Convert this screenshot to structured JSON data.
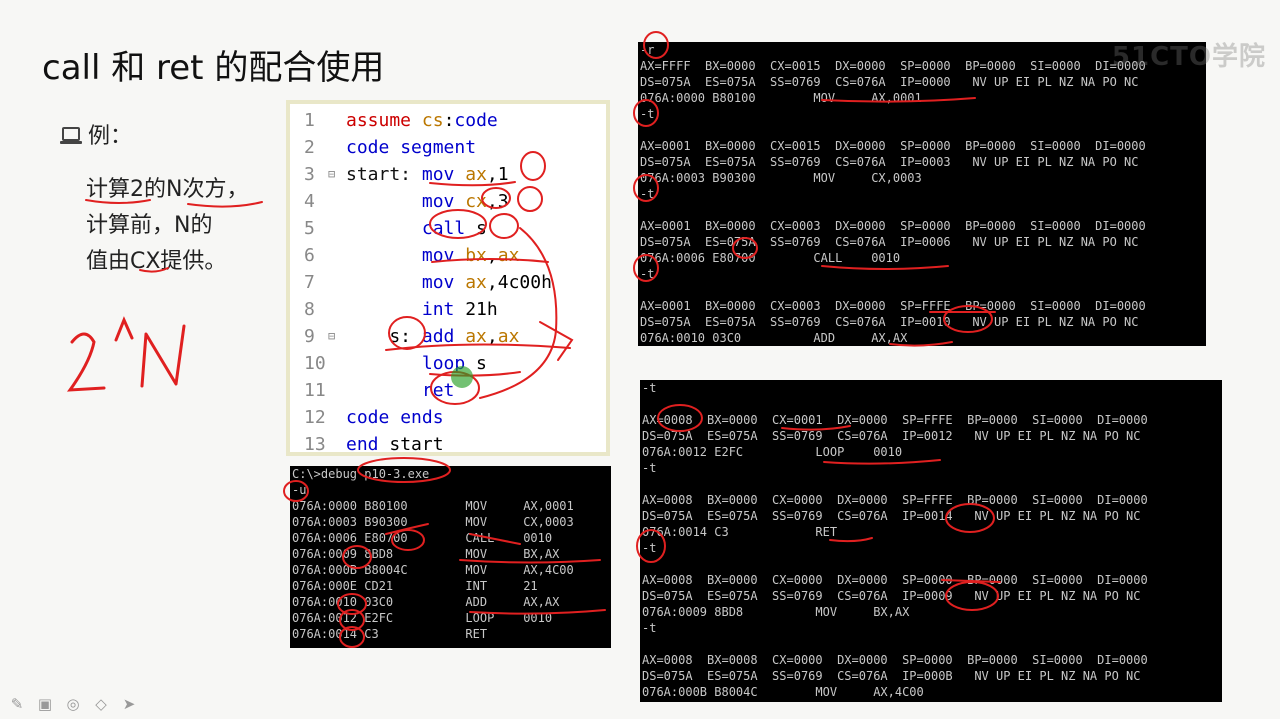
{
  "slide": {
    "title": "call 和 ret 的配合使用",
    "example_label": "例：",
    "description": [
      "计算2的N次方，",
      "计算前，N的",
      "值由CX提供。"
    ],
    "handwriting": "2^N",
    "watermark": "51CTO学院"
  },
  "code": {
    "lines": [
      {
        "n": "1",
        "fold": "",
        "text": "assume cs:code"
      },
      {
        "n": "2",
        "fold": "",
        "text": "code segment"
      },
      {
        "n": "3",
        "fold": "⊟",
        "text": "start: mov ax,1"
      },
      {
        "n": "4",
        "fold": "",
        "text": "       mov cx,3"
      },
      {
        "n": "5",
        "fold": "",
        "text": "       call s"
      },
      {
        "n": "6",
        "fold": "",
        "text": "       mov bx,ax"
      },
      {
        "n": "7",
        "fold": "",
        "text": "       mov ax,4c00h"
      },
      {
        "n": "8",
        "fold": "",
        "text": "       int 21h"
      },
      {
        "n": "9",
        "fold": "⊟",
        "text": "    s: add ax,ax"
      },
      {
        "n": "10",
        "fold": "",
        "text": "       loop s"
      },
      {
        "n": "11",
        "fold": "",
        "text": "       ret"
      },
      {
        "n": "12",
        "fold": "",
        "text": "code ends"
      },
      {
        "n": "13",
        "fold": "",
        "text": "end start"
      }
    ]
  },
  "terminal_top": {
    "lines": [
      "-r",
      "AX=FFFF  BX=0000  CX=0015  DX=0000  SP=0000  BP=0000  SI=0000  DI=0000",
      "DS=075A  ES=075A  SS=0769  CS=076A  IP=0000   NV UP EI PL NZ NA PO NC",
      "076A:0000 B80100        MOV     AX,0001",
      "-t",
      "",
      "AX=0001  BX=0000  CX=0015  DX=0000  SP=0000  BP=0000  SI=0000  DI=0000",
      "DS=075A  ES=075A  SS=0769  CS=076A  IP=0003   NV UP EI PL NZ NA PO NC",
      "076A:0003 B90300        MOV     CX,0003",
      "-t",
      "",
      "AX=0001  BX=0000  CX=0003  DX=0000  SP=0000  BP=0000  SI=0000  DI=0000",
      "DS=075A  ES=075A  SS=0769  CS=076A  IP=0006   NV UP EI PL NZ NA PO NC",
      "076A:0006 E80700        CALL    0010",
      "-t",
      "",
      "AX=0001  BX=0000  CX=0003  DX=0000  SP=FFFE  BP=0000  SI=0000  DI=0000",
      "DS=075A  ES=075A  SS=0769  CS=076A  IP=0010   NV UP EI PL NZ NA PO NC",
      "076A:0010 03C0          ADD     AX,AX"
    ]
  },
  "terminal_bottom": {
    "lines": [
      "-t",
      "",
      "AX=0008  BX=0000  CX=0001  DX=0000  SP=FFFE  BP=0000  SI=0000  DI=0000",
      "DS=075A  ES=075A  SS=0769  CS=076A  IP=0012   NV UP EI PL NZ NA PO NC",
      "076A:0012 E2FC          LOOP    0010",
      "-t",
      "",
      "AX=0008  BX=0000  CX=0000  DX=0000  SP=FFFE  BP=0000  SI=0000  DI=0000",
      "DS=075A  ES=075A  SS=0769  CS=076A  IP=0014   NV UP EI PL NZ NA PO NC",
      "076A:0014 C3            RET",
      "-t",
      "",
      "AX=0008  BX=0000  CX=0000  DX=0000  SP=0000  BP=0000  SI=0000  DI=0000",
      "DS=075A  ES=075A  SS=0769  CS=076A  IP=0009   NV UP EI PL NZ NA PO NC",
      "076A:0009 8BD8          MOV     BX,AX",
      "-t",
      "",
      "AX=0008  BX=0008  CX=0000  DX=0000  SP=0000  BP=0000  SI=0000  DI=0000",
      "DS=075A  ES=075A  SS=0769  CS=076A  IP=000B   NV UP EI PL NZ NA PO NC",
      "076A:000B B8004C        MOV     AX,4C00"
    ]
  },
  "terminal_debug": {
    "lines": [
      "C:\\>debug p10-3.exe",
      "-u",
      "076A:0000 B80100        MOV     AX,0001",
      "076A:0003 B90300        MOV     CX,0003",
      "076A:0006 E80700        CALL    0010",
      "076A:0009 8BD8          MOV     BX,AX",
      "076A:000B B8004C        MOV     AX,4C00",
      "076A:000E CD21          INT     21",
      "076A:0010 03C0          ADD     AX,AX",
      "076A:0012 E2FC          LOOP    0010",
      "076A:0014 C3            RET"
    ]
  },
  "toolbar": {
    "icons": [
      "pen-icon",
      "screen-icon",
      "highlighter-icon",
      "eraser-icon",
      "pointer-icon"
    ]
  },
  "colors": {
    "annotation": "#e02020",
    "terminal_bg": "#000000",
    "terminal_fg": "#c8c8c8"
  }
}
